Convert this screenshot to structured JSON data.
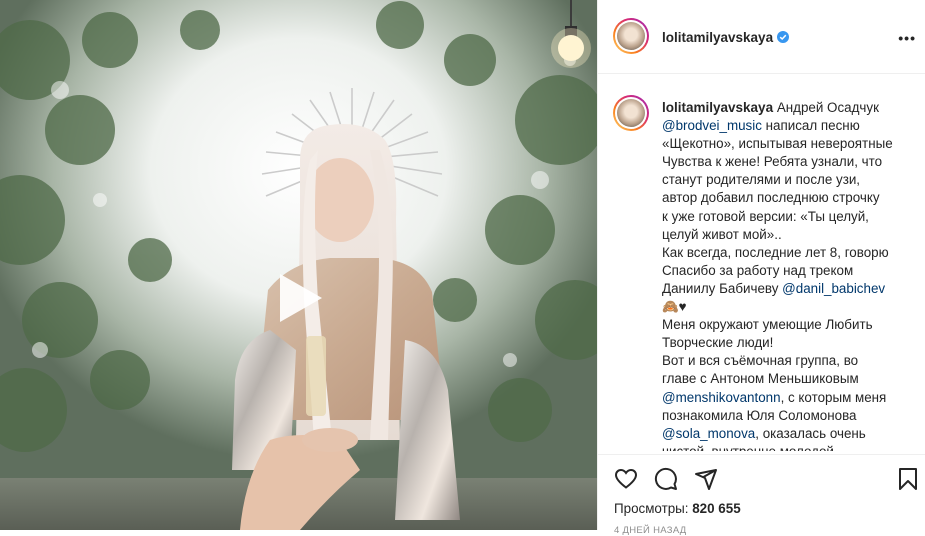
{
  "post": {
    "username": "lolitamilyavskaya",
    "verified": true,
    "more_label": "•••"
  },
  "caption": {
    "lines": [
      [
        {
          "t": "Андрей Осадчук"
        }
      ],
      [
        {
          "t": "@brodvei_music",
          "m": true
        },
        {
          "t": " написал песню"
        }
      ],
      [
        {
          "t": "«Щекотно», испытывая невероятные"
        }
      ],
      [
        {
          "t": "Чувства к жене! Ребята узнали, что"
        }
      ],
      [
        {
          "t": "станут родителями и после узи,"
        }
      ],
      [
        {
          "t": "автор добавил последнюю строчку"
        }
      ],
      [
        {
          "t": "к уже готовой версии: «Ты целуй,"
        }
      ],
      [
        {
          "t": "целуй живот мой».."
        }
      ],
      [
        {
          "t": "Как всегда, последние лет 8, говорю"
        }
      ],
      [
        {
          "t": "Спасибо за работу над треком"
        }
      ],
      [
        {
          "t": "Даниилу Бабичеву "
        },
        {
          "t": "@danil_babichev",
          "m": true
        }
      ],
      [
        {
          "t": "🙈♥"
        }
      ],
      [
        {
          "t": "Меня окружают умеющие Любить"
        }
      ],
      [
        {
          "t": "Творческие люди!"
        }
      ],
      [
        {
          "t": "Вот и вся съёмочная группа, во"
        }
      ],
      [
        {
          "t": "главе с Антоном Меньшиковым"
        }
      ],
      [
        {
          "t": "@menshikovantonn",
          "m": true
        },
        {
          "t": ", с которым меня"
        }
      ],
      [
        {
          "t": "познакомила Юля Соломонова"
        }
      ],
      [
        {
          "t": "@sola_monova",
          "m": true
        },
        {
          "t": ", оказалась очень"
        }
      ],
      [
        {
          "t": "чистой, внутренне молодой"
        }
      ]
    ]
  },
  "icons": {
    "like": "heart-icon",
    "comment": "comment-icon",
    "share": "share-icon",
    "save": "bookmark-icon",
    "play": "play-icon"
  },
  "stats": {
    "views_label": "Просмотры:",
    "views_value": "820 655",
    "time_ago": "4 ДНЕЙ НАЗАД"
  },
  "colors": {
    "verified": "#3897f0",
    "mention": "#00376b",
    "text": "#262626",
    "muted": "#8e8e8e"
  }
}
